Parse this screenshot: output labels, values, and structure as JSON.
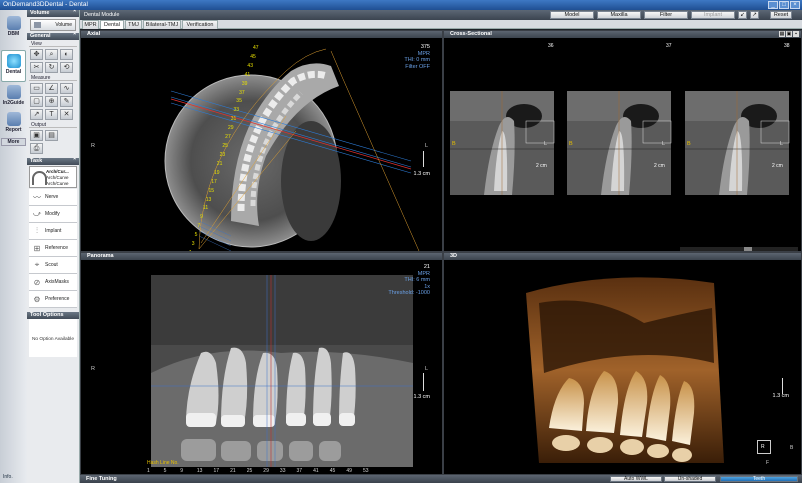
{
  "window": {
    "title": "OnDemand3DDental - Dental"
  },
  "leftbar": {
    "items": [
      "DBM",
      "Dental",
      "In2Guide",
      "Report",
      "More"
    ],
    "info": "Info."
  },
  "panel": {
    "volume": {
      "header": "Volume",
      "button": "Volume"
    },
    "general": {
      "header": "General",
      "view_label": "View",
      "measure_label": "Measure",
      "output_label": "Output"
    },
    "task": {
      "header": "Task",
      "arch_title": "Arch/Cur...",
      "arch_sub1": "Arch/Curve",
      "arch_sub2": "Arch/Curve",
      "items": [
        "Nerve",
        "Modify",
        "Implant",
        "Reference",
        "Scout",
        "AxisMasks",
        "Preference"
      ]
    },
    "tool_options": {
      "header": "Tool Options",
      "empty": "No Option Available"
    }
  },
  "top": {
    "module": "Dental Module",
    "buttons": [
      "Model",
      "Maxilla",
      "Filter",
      "Implant"
    ],
    "reset": "Reset"
  },
  "tabs": [
    "MPR",
    "Dental",
    "TMJ",
    "Bilateral-TMJ",
    "Verification"
  ],
  "active_tab": "Dental",
  "views": {
    "axial": {
      "title": "Axial",
      "info": [
        "375",
        "MPR",
        "THI: 0 mm",
        "Filter OFF"
      ],
      "scale": "1.3 cm",
      "left": "R",
      "right": "L",
      "numbers": [
        "47",
        "45",
        "43",
        "41",
        "39",
        "37",
        "35",
        "33",
        "31",
        "29",
        "27",
        "25",
        "23",
        "21",
        "19",
        "17",
        "15",
        "13",
        "11",
        "9",
        "7",
        "5",
        "3",
        "1"
      ]
    },
    "cross": {
      "title": "Cross-Sectional",
      "slices": [
        "36",
        "37",
        "38"
      ],
      "scale": "2 cm",
      "b": "B",
      "l": "L"
    },
    "panorama": {
      "title": "Panorama",
      "info_num": "21",
      "info": [
        "MPR",
        "THI: 6 mm",
        "1x",
        "Threshold: -1000"
      ],
      "scale": "1.3 cm",
      "left": "R",
      "right": "L",
      "hash_label": "Hash Line No.",
      "numbers": [
        "1",
        "5",
        "9",
        "13",
        "17",
        "21",
        "25",
        "29",
        "33",
        "37",
        "41",
        "45",
        "49",
        "53"
      ]
    },
    "vr3d": {
      "title": "3D",
      "scale": "1.3 cm",
      "box_r": "R",
      "box_b": "B",
      "box_f": "F"
    }
  },
  "bottom": {
    "label": "Fine Tuning",
    "buttons": [
      "Auto WWL",
      "Un-shaded",
      "Teeth"
    ]
  },
  "colors": {
    "accent": "#2170b8",
    "info_text": "#6aa0e6",
    "numbers": "#e8e000"
  }
}
